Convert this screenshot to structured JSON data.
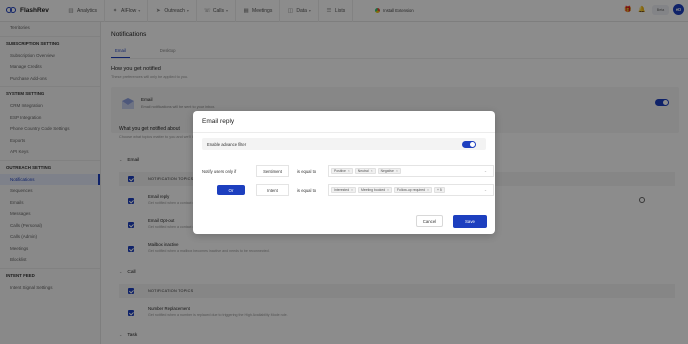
{
  "app": {
    "name": "FlashRev"
  },
  "nav": {
    "items": [
      {
        "label": "Analytics",
        "icon": "analytics-icon",
        "caret": false
      },
      {
        "label": "AIFlow",
        "icon": "aiflow-icon",
        "caret": true
      },
      {
        "label": "Outreach",
        "icon": "outreach-icon",
        "caret": true
      },
      {
        "label": "Calls",
        "icon": "phone-icon",
        "caret": true
      },
      {
        "label": "Meetings",
        "icon": "calendar-icon",
        "caret": false
      },
      {
        "label": "Data",
        "icon": "data-icon",
        "caret": true
      },
      {
        "label": "Lists",
        "icon": "list-icon",
        "caret": false
      }
    ],
    "extension": "Install Extension",
    "badge": "Beta",
    "avatar": "eD"
  },
  "sidebar": {
    "top": [
      "Territories"
    ],
    "sections": [
      {
        "title": "SUBSCRIPTION SETTING",
        "items": [
          "Subscription Overview",
          "Manage Credits",
          "Purchase Add-ons"
        ]
      },
      {
        "title": "SYSTEM SETTING",
        "items": [
          "CRM Integration",
          "ESP Integration",
          "Phone Country Code Settings",
          "Exports",
          "API Keys"
        ]
      },
      {
        "title": "OUTREACH SETTING",
        "items": [
          "Notifications",
          "Sequences",
          "Emails",
          "Messages",
          "Calls (Personal)",
          "Calls (Admin)",
          "Meetings",
          "Blocklist"
        ]
      },
      {
        "title": "INTENT FEED",
        "items": [
          "Intent Signal Settings"
        ]
      }
    ],
    "active": "Notifications"
  },
  "main": {
    "title": "Notifications",
    "tabs": [
      "Email",
      "Desktop"
    ],
    "how_title": "How you get notified",
    "how_sub": "These preferences will only be applied to you.",
    "email_card": {
      "title": "Email",
      "sub": "Email notifications will be sent to your inbox.",
      "enabled": true
    },
    "what_title": "What you get notified about",
    "what_sub": "Choose what topics matter to you and we'll keep you updated.",
    "email_group": "Email",
    "topics_header": "NOTIFICATION TOPICS",
    "email_items": [
      {
        "title": "Email reply",
        "sub": "Get notified when a contact replies to your email."
      },
      {
        "title": "Email Opt-out",
        "sub": "Get notified when a contact opts out of your emails."
      },
      {
        "title": "Mailbox inactive",
        "sub": "Get notified when a mailbox becomes inactive and needs to be reconnected."
      }
    ],
    "call_group": "Call",
    "call_items": [
      {
        "title": "Number Replacement",
        "sub": "Get notified when a number is replaced due to triggering the High Availability Mode rule."
      }
    ],
    "task_group": "Task"
  },
  "modal": {
    "title": "Email reply",
    "advance_filter_label": "Enable advance filter",
    "advance_filter_enabled": true,
    "rules": [
      {
        "label": "Notify users only if",
        "field": "Sentiment",
        "operator": "is equal to",
        "values": [
          "Positive",
          "Neutral",
          "Negative"
        ],
        "more": ""
      },
      {
        "button": "Or",
        "field": "Intent",
        "operator": "is equal to",
        "values": [
          "Interested",
          "Meeting booked",
          "Follow-up required"
        ],
        "more": "+ 5"
      }
    ],
    "cancel_label": "Cancel",
    "save_label": "Save"
  },
  "colors": {
    "brand": "#1d3fbf",
    "overlay": "rgba(0,0,0,0.45)"
  }
}
